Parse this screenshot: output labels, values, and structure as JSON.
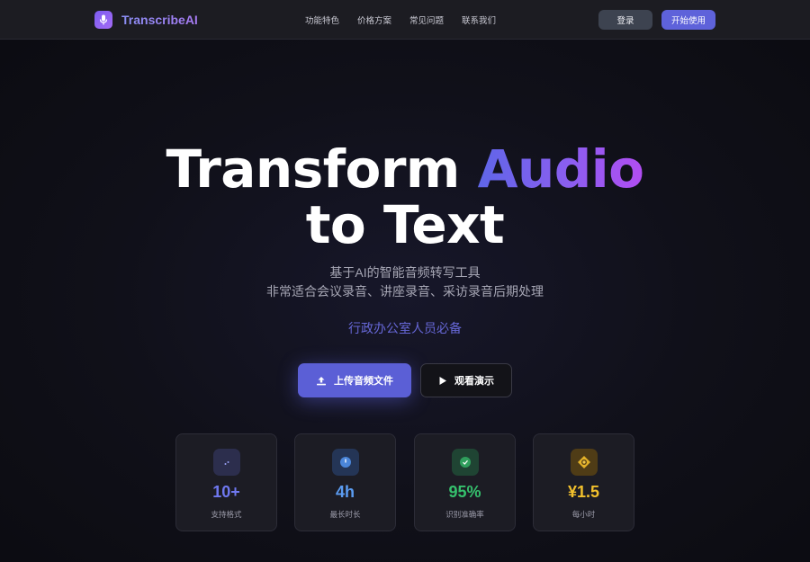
{
  "header": {
    "brand": "TranscribeAI",
    "nav": [
      "功能特色",
      "价格方案",
      "常见问题",
      "联系我们"
    ],
    "login_label": "登录",
    "start_label": "开始使用"
  },
  "hero": {
    "title_part1": "Transform ",
    "title_highlight": "Audio",
    "title_line2": "to Text",
    "subtitle_line1": "基于AI的智能音频转写工具",
    "subtitle_line2": "非常适合会议录音、讲座录音、采访录音后期处理",
    "tagline": "行政办公室人员必备",
    "upload_label": "上传音频文件",
    "demo_label": "观看演示"
  },
  "stats": [
    {
      "value": "10+",
      "label": "支持格式",
      "icon": "formats-icon",
      "color": "#6f78f0"
    },
    {
      "value": "4h",
      "label": "最长时长",
      "icon": "clock-icon",
      "color": "#5b9cf2"
    },
    {
      "value": "95%",
      "label": "识别准确率",
      "icon": "check-icon",
      "color": "#35c06d"
    },
    {
      "value": "¥1.5",
      "label": "每小时",
      "icon": "coin-icon",
      "color": "#f2c02c"
    }
  ],
  "colors": {
    "accent": "#5e62da",
    "background": "#101019"
  }
}
